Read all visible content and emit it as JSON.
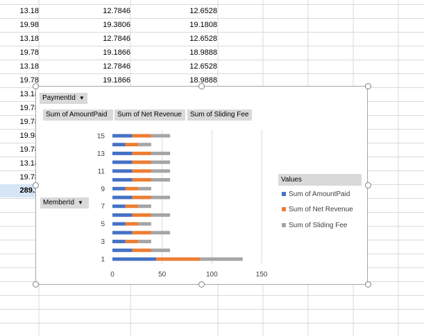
{
  "sheet": {
    "rows": [
      {
        "a": "13.18",
        "b": "12.7846",
        "c": "12.6528"
      },
      {
        "a": "19.98",
        "b": "19.3806",
        "c": "19.1808"
      },
      {
        "a": "13.18",
        "b": "12.7846",
        "c": "12.6528"
      },
      {
        "a": "19.78",
        "b": "19.1866",
        "c": "18.9888"
      },
      {
        "a": "13.18",
        "b": "12.7846",
        "c": "12.6528"
      },
      {
        "a": "19.78",
        "b": "19.1866",
        "c": "18.9888"
      },
      {
        "a": "13.18",
        "b": "",
        "c": ""
      },
      {
        "a": "19.78",
        "b": "",
        "c": ""
      },
      {
        "a": "19.78",
        "b": "",
        "c": ""
      },
      {
        "a": "19.98",
        "b": "",
        "c": ""
      },
      {
        "a": "19.78",
        "b": "",
        "c": ""
      },
      {
        "a": "13.18",
        "b": "",
        "c": ""
      },
      {
        "a": "19.78",
        "b": "",
        "c": ""
      }
    ],
    "total": "289.1"
  },
  "pivot_chart": {
    "filter_field": "PaymentId",
    "axis_field": "MemberId",
    "value_fields": [
      "Sum of AmountPaid",
      "Sum of Net Revenue",
      "Sum of Sliding Fee"
    ],
    "legend_title": "Values"
  },
  "colors": {
    "series1": "#4472c4",
    "series2": "#ed7d31",
    "series3": "#a5a5a5",
    "gridline": "#d9d9d9",
    "selection": "#d6e5f5"
  },
  "chart_data": {
    "type": "bar",
    "orientation": "horizontal",
    "stacked": true,
    "categories": [
      "1",
      "2",
      "3",
      "4",
      "5",
      "6",
      "7",
      "8",
      "9",
      "10",
      "11",
      "12",
      "13",
      "14",
      "15"
    ],
    "series": [
      {
        "name": "Sum of AmountPaid",
        "values": [
          44,
          20,
          13,
          20,
          13,
          20,
          13,
          20,
          13,
          20,
          20,
          20,
          20,
          13,
          20
        ]
      },
      {
        "name": "Sum of Net Revenue",
        "values": [
          44,
          19,
          13,
          19,
          13,
          19,
          13,
          19,
          13,
          19,
          19,
          19,
          19,
          13,
          19
        ]
      },
      {
        "name": "Sum of Sliding Fee",
        "values": [
          43,
          19,
          13,
          19,
          13,
          19,
          13,
          19,
          13,
          19,
          19,
          19,
          19,
          13,
          19
        ]
      }
    ],
    "xlim": [
      0,
      150
    ],
    "x_ticks": [
      "0",
      "50",
      "100",
      "150"
    ],
    "y_tick_labels": [
      "1",
      "3",
      "5",
      "7",
      "9",
      "11",
      "13",
      "15"
    ],
    "grid": true,
    "legend": "right"
  }
}
